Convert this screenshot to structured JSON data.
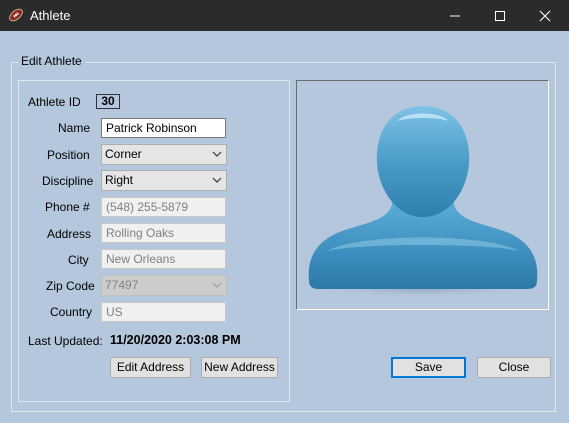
{
  "window": {
    "title": "Athlete",
    "icon": "football-icon",
    "controls": [
      "minimize",
      "maximize",
      "close"
    ]
  },
  "group": {
    "legend": "Edit Athlete"
  },
  "form": {
    "athlete_id": {
      "label": "Athlete ID",
      "value": "30"
    },
    "name": {
      "label": "Name",
      "value": "Patrick Robinson"
    },
    "position": {
      "label": "Position",
      "value": "Corner"
    },
    "discipline": {
      "label": "Discipline",
      "value": "Right"
    },
    "phone": {
      "label": "Phone #",
      "value": "(548) 255-5879"
    },
    "address": {
      "label": "Address",
      "value": "Rolling Oaks"
    },
    "city": {
      "label": "City",
      "value": "New Orleans"
    },
    "zip": {
      "label": "Zip Code",
      "value": "77497"
    },
    "country": {
      "label": "Country",
      "value": "US"
    },
    "last_updated": {
      "label": "Last Updated:",
      "value": "11/20/2020 2:03:08 PM"
    }
  },
  "buttons": {
    "edit_address": "Edit Address",
    "new_address": "New Address",
    "save": "Save",
    "close": "Close"
  },
  "photo": {
    "icon": "person-silhouette-icon"
  },
  "colors": {
    "background": "#b4c7dc",
    "titlebar": "#2b2b2b",
    "silhouette": "#4a9cc8",
    "accent": "#0078d7"
  }
}
